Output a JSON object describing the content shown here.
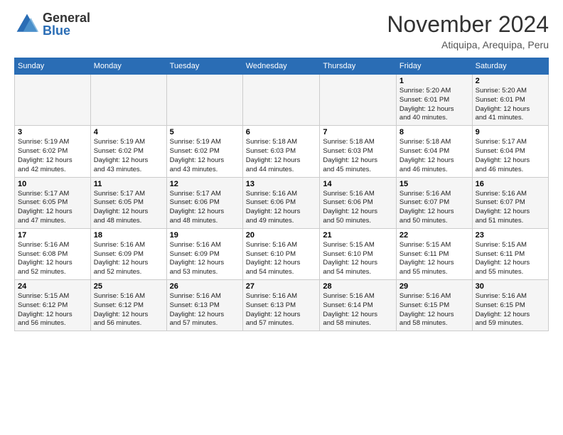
{
  "logo": {
    "general": "General",
    "blue": "Blue"
  },
  "header": {
    "month": "November 2024",
    "location": "Atiquipa, Arequipa, Peru"
  },
  "weekdays": [
    "Sunday",
    "Monday",
    "Tuesday",
    "Wednesday",
    "Thursday",
    "Friday",
    "Saturday"
  ],
  "weeks": [
    [
      {
        "day": "",
        "info": ""
      },
      {
        "day": "",
        "info": ""
      },
      {
        "day": "",
        "info": ""
      },
      {
        "day": "",
        "info": ""
      },
      {
        "day": "",
        "info": ""
      },
      {
        "day": "1",
        "info": "Sunrise: 5:20 AM\nSunset: 6:01 PM\nDaylight: 12 hours\nand 40 minutes."
      },
      {
        "day": "2",
        "info": "Sunrise: 5:20 AM\nSunset: 6:01 PM\nDaylight: 12 hours\nand 41 minutes."
      }
    ],
    [
      {
        "day": "3",
        "info": "Sunrise: 5:19 AM\nSunset: 6:02 PM\nDaylight: 12 hours\nand 42 minutes."
      },
      {
        "day": "4",
        "info": "Sunrise: 5:19 AM\nSunset: 6:02 PM\nDaylight: 12 hours\nand 43 minutes."
      },
      {
        "day": "5",
        "info": "Sunrise: 5:19 AM\nSunset: 6:02 PM\nDaylight: 12 hours\nand 43 minutes."
      },
      {
        "day": "6",
        "info": "Sunrise: 5:18 AM\nSunset: 6:03 PM\nDaylight: 12 hours\nand 44 minutes."
      },
      {
        "day": "7",
        "info": "Sunrise: 5:18 AM\nSunset: 6:03 PM\nDaylight: 12 hours\nand 45 minutes."
      },
      {
        "day": "8",
        "info": "Sunrise: 5:18 AM\nSunset: 6:04 PM\nDaylight: 12 hours\nand 46 minutes."
      },
      {
        "day": "9",
        "info": "Sunrise: 5:17 AM\nSunset: 6:04 PM\nDaylight: 12 hours\nand 46 minutes."
      }
    ],
    [
      {
        "day": "10",
        "info": "Sunrise: 5:17 AM\nSunset: 6:05 PM\nDaylight: 12 hours\nand 47 minutes."
      },
      {
        "day": "11",
        "info": "Sunrise: 5:17 AM\nSunset: 6:05 PM\nDaylight: 12 hours\nand 48 minutes."
      },
      {
        "day": "12",
        "info": "Sunrise: 5:17 AM\nSunset: 6:06 PM\nDaylight: 12 hours\nand 48 minutes."
      },
      {
        "day": "13",
        "info": "Sunrise: 5:16 AM\nSunset: 6:06 PM\nDaylight: 12 hours\nand 49 minutes."
      },
      {
        "day": "14",
        "info": "Sunrise: 5:16 AM\nSunset: 6:06 PM\nDaylight: 12 hours\nand 50 minutes."
      },
      {
        "day": "15",
        "info": "Sunrise: 5:16 AM\nSunset: 6:07 PM\nDaylight: 12 hours\nand 50 minutes."
      },
      {
        "day": "16",
        "info": "Sunrise: 5:16 AM\nSunset: 6:07 PM\nDaylight: 12 hours\nand 51 minutes."
      }
    ],
    [
      {
        "day": "17",
        "info": "Sunrise: 5:16 AM\nSunset: 6:08 PM\nDaylight: 12 hours\nand 52 minutes."
      },
      {
        "day": "18",
        "info": "Sunrise: 5:16 AM\nSunset: 6:09 PM\nDaylight: 12 hours\nand 52 minutes."
      },
      {
        "day": "19",
        "info": "Sunrise: 5:16 AM\nSunset: 6:09 PM\nDaylight: 12 hours\nand 53 minutes."
      },
      {
        "day": "20",
        "info": "Sunrise: 5:16 AM\nSunset: 6:10 PM\nDaylight: 12 hours\nand 54 minutes."
      },
      {
        "day": "21",
        "info": "Sunrise: 5:15 AM\nSunset: 6:10 PM\nDaylight: 12 hours\nand 54 minutes."
      },
      {
        "day": "22",
        "info": "Sunrise: 5:15 AM\nSunset: 6:11 PM\nDaylight: 12 hours\nand 55 minutes."
      },
      {
        "day": "23",
        "info": "Sunrise: 5:15 AM\nSunset: 6:11 PM\nDaylight: 12 hours\nand 55 minutes."
      }
    ],
    [
      {
        "day": "24",
        "info": "Sunrise: 5:15 AM\nSunset: 6:12 PM\nDaylight: 12 hours\nand 56 minutes."
      },
      {
        "day": "25",
        "info": "Sunrise: 5:16 AM\nSunset: 6:12 PM\nDaylight: 12 hours\nand 56 minutes."
      },
      {
        "day": "26",
        "info": "Sunrise: 5:16 AM\nSunset: 6:13 PM\nDaylight: 12 hours\nand 57 minutes."
      },
      {
        "day": "27",
        "info": "Sunrise: 5:16 AM\nSunset: 6:13 PM\nDaylight: 12 hours\nand 57 minutes."
      },
      {
        "day": "28",
        "info": "Sunrise: 5:16 AM\nSunset: 6:14 PM\nDaylight: 12 hours\nand 58 minutes."
      },
      {
        "day": "29",
        "info": "Sunrise: 5:16 AM\nSunset: 6:15 PM\nDaylight: 12 hours\nand 58 minutes."
      },
      {
        "day": "30",
        "info": "Sunrise: 5:16 AM\nSunset: 6:15 PM\nDaylight: 12 hours\nand 59 minutes."
      }
    ]
  ]
}
